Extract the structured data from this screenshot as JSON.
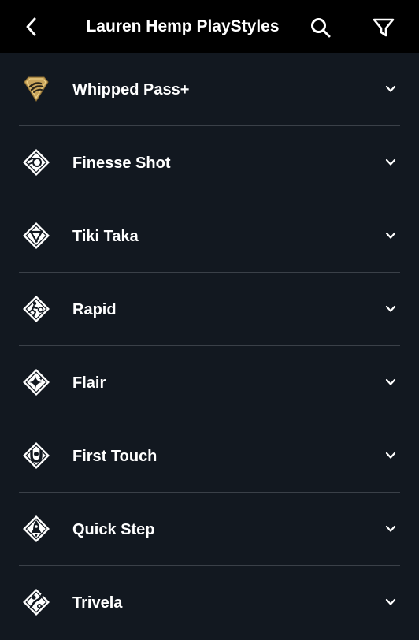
{
  "header": {
    "title": "Lauren Hemp PlayStyles",
    "back_icon": "chevron-left-icon",
    "search_icon": "search-icon",
    "filter_icon": "filter-icon"
  },
  "colors": {
    "background": "#121820",
    "header_background": "#000000",
    "text": "#ffffff",
    "divider": "#3a4048",
    "plus_gold": "#c9a55c"
  },
  "playstyles": [
    {
      "label": "Whipped Pass+",
      "icon": "whipped-pass-plus-icon",
      "plus": true
    },
    {
      "label": "Finesse Shot",
      "icon": "finesse-shot-icon",
      "plus": false
    },
    {
      "label": "Tiki Taka",
      "icon": "tiki-taka-icon",
      "plus": false
    },
    {
      "label": "Rapid",
      "icon": "rapid-icon",
      "plus": false
    },
    {
      "label": "Flair",
      "icon": "flair-icon",
      "plus": false
    },
    {
      "label": "First Touch",
      "icon": "first-touch-icon",
      "plus": false
    },
    {
      "label": "Quick Step",
      "icon": "quick-step-icon",
      "plus": false
    },
    {
      "label": "Trivela",
      "icon": "trivela-icon",
      "plus": false
    }
  ]
}
